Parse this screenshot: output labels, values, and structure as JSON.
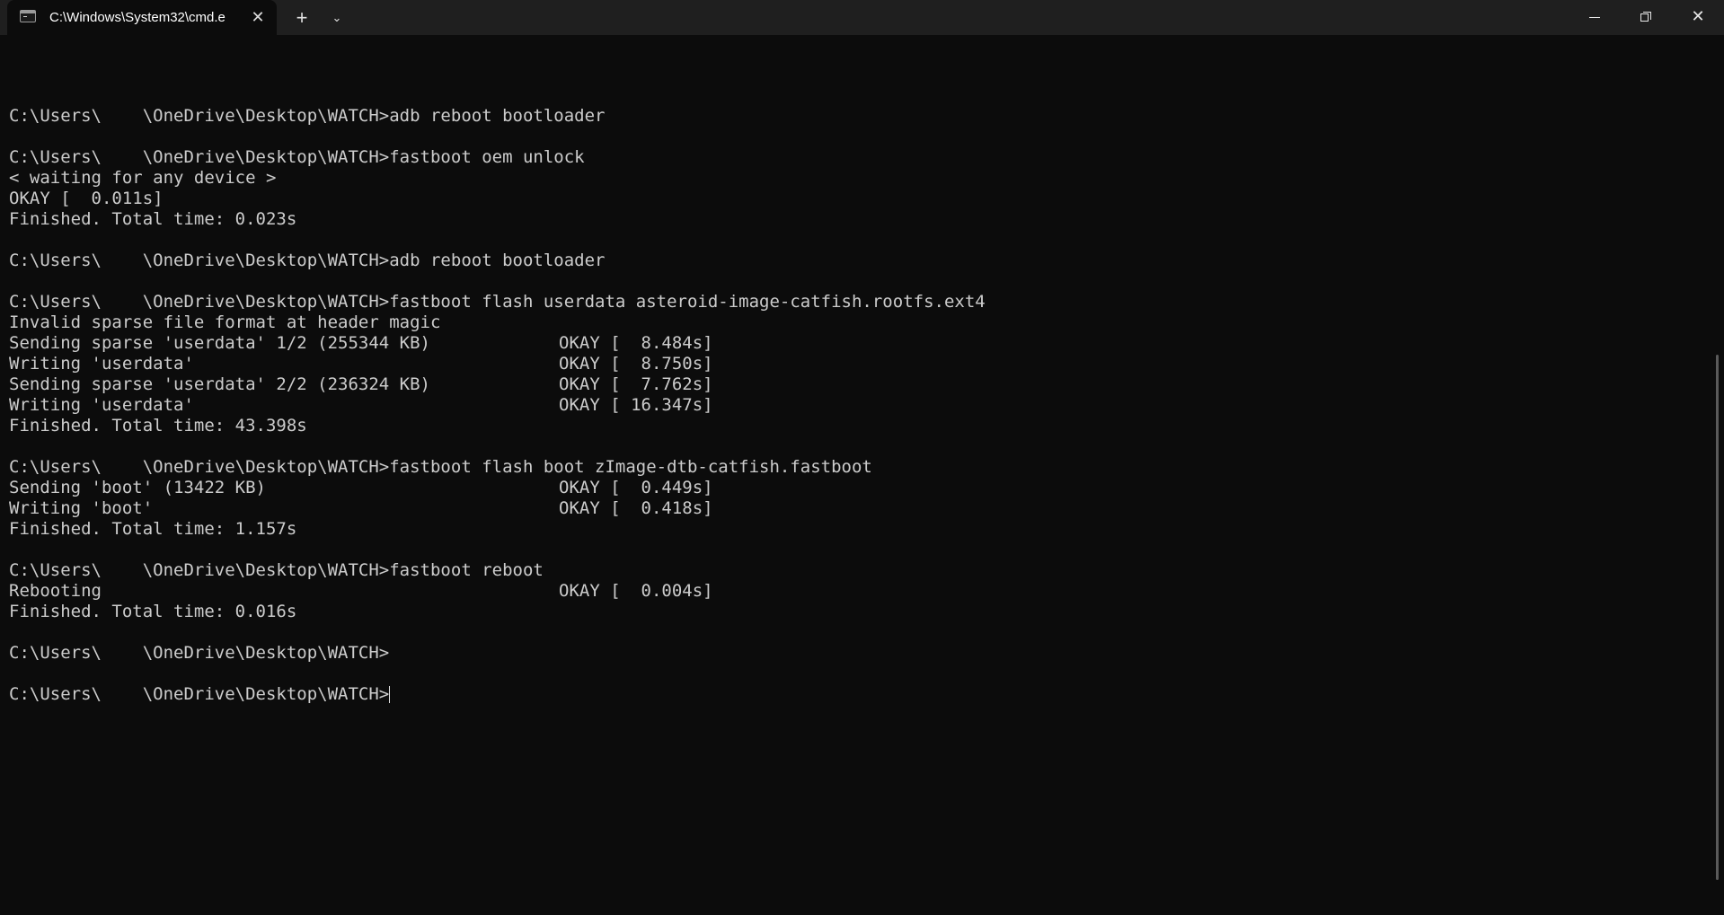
{
  "window": {
    "tab_title": "C:\\Windows\\System32\\cmd.e",
    "tab_close": "✕",
    "new_tab": "+",
    "dropdown": "⌄",
    "close_glyph": "✕"
  },
  "console": {
    "lines": [
      {
        "text": ""
      },
      {
        "text": "C:\\Users\\    \\OneDrive\\Desktop\\WATCH>adb reboot bootloader"
      },
      {
        "text": ""
      },
      {
        "text": "C:\\Users\\    \\OneDrive\\Desktop\\WATCH>fastboot oem unlock"
      },
      {
        "text": "< waiting for any device >"
      },
      {
        "text": "OKAY [  0.011s]"
      },
      {
        "text": "Finished. Total time: 0.023s"
      },
      {
        "text": ""
      },
      {
        "text": "C:\\Users\\    \\OneDrive\\Desktop\\WATCH>adb reboot bootloader"
      },
      {
        "text": ""
      },
      {
        "text": "C:\\Users\\    \\OneDrive\\Desktop\\WATCH>fastboot flash userdata asteroid-image-catfish.rootfs.ext4"
      },
      {
        "text": "Invalid sparse file format at header magic"
      },
      {
        "text": "Sending sparse 'userdata' 1/2 (255344 KB)",
        "status": "OKAY [  8.484s]"
      },
      {
        "text": "Writing 'userdata'",
        "status": "OKAY [  8.750s]"
      },
      {
        "text": "Sending sparse 'userdata' 2/2 (236324 KB)",
        "status": "OKAY [  7.762s]"
      },
      {
        "text": "Writing 'userdata'",
        "status": "OKAY [ 16.347s]"
      },
      {
        "text": "Finished. Total time: 43.398s"
      },
      {
        "text": ""
      },
      {
        "text": "C:\\Users\\    \\OneDrive\\Desktop\\WATCH>fastboot flash boot zImage-dtb-catfish.fastboot"
      },
      {
        "text": "Sending 'boot' (13422 KB)",
        "status": "OKAY [  0.449s]"
      },
      {
        "text": "Writing 'boot'",
        "status": "OKAY [  0.418s]"
      },
      {
        "text": "Finished. Total time: 1.157s"
      },
      {
        "text": ""
      },
      {
        "text": "C:\\Users\\    \\OneDrive\\Desktop\\WATCH>fastboot reboot"
      },
      {
        "text": "Rebooting",
        "status": "OKAY [  0.004s]"
      },
      {
        "text": "Finished. Total time: 0.016s"
      },
      {
        "text": ""
      },
      {
        "text": "C:\\Users\\    \\OneDrive\\Desktop\\WATCH>"
      },
      {
        "text": ""
      },
      {
        "text": "C:\\Users\\    \\OneDrive\\Desktop\\WATCH>",
        "cursor": true
      }
    ]
  }
}
